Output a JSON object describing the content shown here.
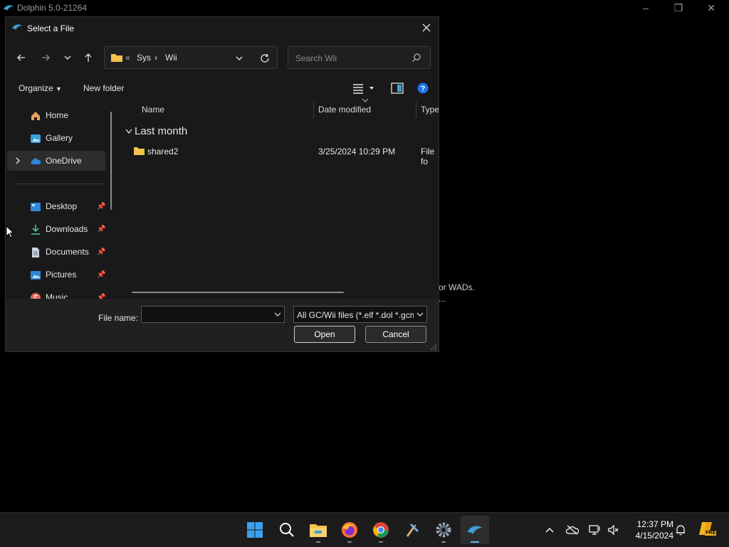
{
  "background_window": {
    "title": "Dolphin 5.0-21264",
    "text_line1": "or WADs.",
    "text_line2": "..."
  },
  "dialog": {
    "title": "Select a File",
    "breadcrumb": {
      "overflow": "«",
      "parts": [
        "Sys",
        "Wii"
      ]
    },
    "search_placeholder": "Search Wii",
    "toolbar": {
      "organize": "Organize",
      "new_folder": "New folder"
    },
    "nav": {
      "items": [
        {
          "label": "Home",
          "icon": "home-icon"
        },
        {
          "label": "Gallery",
          "icon": "gallery-icon"
        },
        {
          "label": "OneDrive",
          "icon": "cloud-icon"
        },
        {
          "label": "Desktop",
          "icon": "desktop-icon",
          "pinned": true
        },
        {
          "label": "Downloads",
          "icon": "download-icon",
          "pinned": true
        },
        {
          "label": "Documents",
          "icon": "document-icon",
          "pinned": true
        },
        {
          "label": "Pictures",
          "icon": "pictures-icon",
          "pinned": true
        },
        {
          "label": "Music",
          "icon": "music-icon",
          "pinned": true
        }
      ]
    },
    "columns": {
      "name": "Name",
      "date": "Date modified",
      "type": "Type"
    },
    "group": "Last month",
    "rows": [
      {
        "name": "shared2",
        "date": "3/25/2024 10:29 PM",
        "type": "File fo"
      }
    ],
    "footer": {
      "file_name_label": "File name:",
      "file_name_value": "",
      "filter": "All GC/Wii files (*.elf *.dol *.gcm",
      "open": "Open",
      "cancel": "Cancel"
    }
  },
  "taskbar": {
    "time": "12:37 PM",
    "date": "4/15/2024",
    "badge": "PRE"
  },
  "colors": {
    "accent": "#0078d4",
    "folder": "#f2c14e",
    "dialog_bg": "#191919",
    "taskbar_bg": "#1c1c1c"
  }
}
